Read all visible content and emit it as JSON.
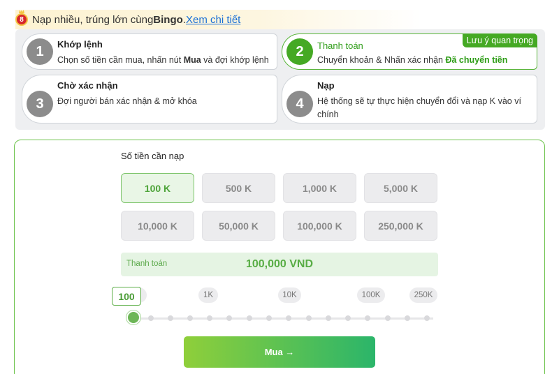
{
  "promo": {
    "logo_text": "8",
    "text_before": "Nạp nhiều, trúng lớn cùng ",
    "brand": "Bingo",
    "text_after": ". ",
    "link": "Xem chi tiết"
  },
  "steps": [
    {
      "num": "1",
      "title": "Khớp lệnh",
      "desc_pre": "Chọn số tiền cần mua, nhấn nút ",
      "desc_bold": "Mua",
      "desc_post": " và đợi khớp lệnh"
    },
    {
      "num": "2",
      "title": "Thanh toán",
      "desc_pre": "Chuyển khoản & Nhấn xác nhận ",
      "desc_bold": "Đã chuyển tiền",
      "badge": "Lưu ý quan trọng"
    },
    {
      "num": "3",
      "title": "Chờ xác nhận",
      "desc": "Đợi người bán xác nhận & mở khóa"
    },
    {
      "num": "4",
      "title": "Nạp",
      "desc": "Hệ thống sẽ tự thực hiện chuyển đổi và nạp K vào ví chính"
    }
  ],
  "form": {
    "amount_label": "Số tiền cần nạp",
    "amounts": [
      "100 K",
      "500 K",
      "1,000 K",
      "5,000 K",
      "10,000 K",
      "50,000 K",
      "100,000 K",
      "250,000 K"
    ],
    "selected_amount": "100 K",
    "payment_label": "Thanh toán",
    "payment_value": "100,000 VND",
    "slider": {
      "value_label": "100",
      "ticks": [
        "1K",
        "10K",
        "100K",
        "250K"
      ],
      "position": 0
    },
    "buy_label": "Mua →"
  },
  "colors": {
    "accent_green": "#45a924",
    "link_blue": "#1a6fd6",
    "step_gray": "#8c8c8c"
  }
}
